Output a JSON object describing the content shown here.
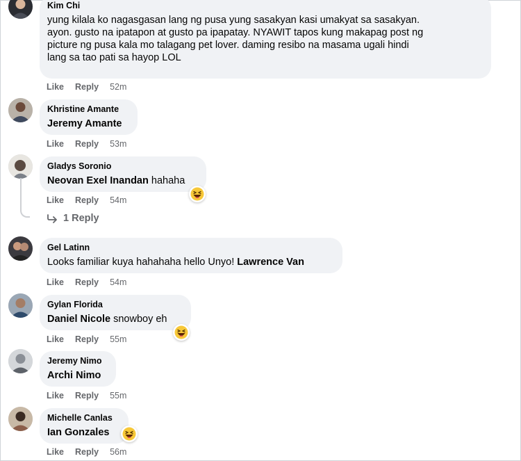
{
  "colors": {
    "bubble": "#f0f2f5",
    "meta": "#65676b",
    "text": "#050505"
  },
  "comments": [
    {
      "author": "Kim Chi",
      "text_lines": [
        "yung kilala ko nagasgasan lang ng pusa yung sasakyan kasi umakyat sa sasakyan.",
        "ayon. gusto na ipatapon at gusto pa ipapatay. NYAWIT tapos kung makapag post ng",
        "picture ng pusa kala mo talagang pet lover. daming resibo na masama ugali hindi",
        "lang sa tao pati sa hayop LOL"
      ],
      "like": "Like",
      "reply": "Reply",
      "time": "52m"
    },
    {
      "author": "Khristine Amante",
      "tag": "Jeremy Amante",
      "rest": "",
      "like": "Like",
      "reply": "Reply",
      "time": "53m"
    },
    {
      "author": "Gladys Soronio",
      "tag": "Neovan Exel Inandan",
      "rest": " hahaha",
      "like": "Like",
      "reply": "Reply",
      "time": "54m",
      "reaction": "haha-emoji-icon"
    },
    {
      "author": "Gel Latinn",
      "plain": "Looks familiar kuya hahahaha hello Unyo! ",
      "tag": "Lawrence Van",
      "like": "Like",
      "reply": "Reply",
      "time": "54m"
    },
    {
      "author": "Gylan Florida",
      "tag": "Daniel Nicole",
      "rest": " snowboy eh",
      "like": "Like",
      "reply": "Reply",
      "time": "55m",
      "reaction": "haha-emoji-icon"
    },
    {
      "author": "Jeremy Nimo",
      "tag": "Archi Nimo",
      "rest": "",
      "like": "Like",
      "reply": "Reply",
      "time": "55m"
    },
    {
      "author": "Michelle Canlas",
      "tag": "Ian Gonzales",
      "rest": "",
      "like": "Like",
      "reply": "Reply",
      "time": "56m",
      "reaction": "haha-emoji-icon"
    }
  ],
  "replies_link": "1 Reply"
}
